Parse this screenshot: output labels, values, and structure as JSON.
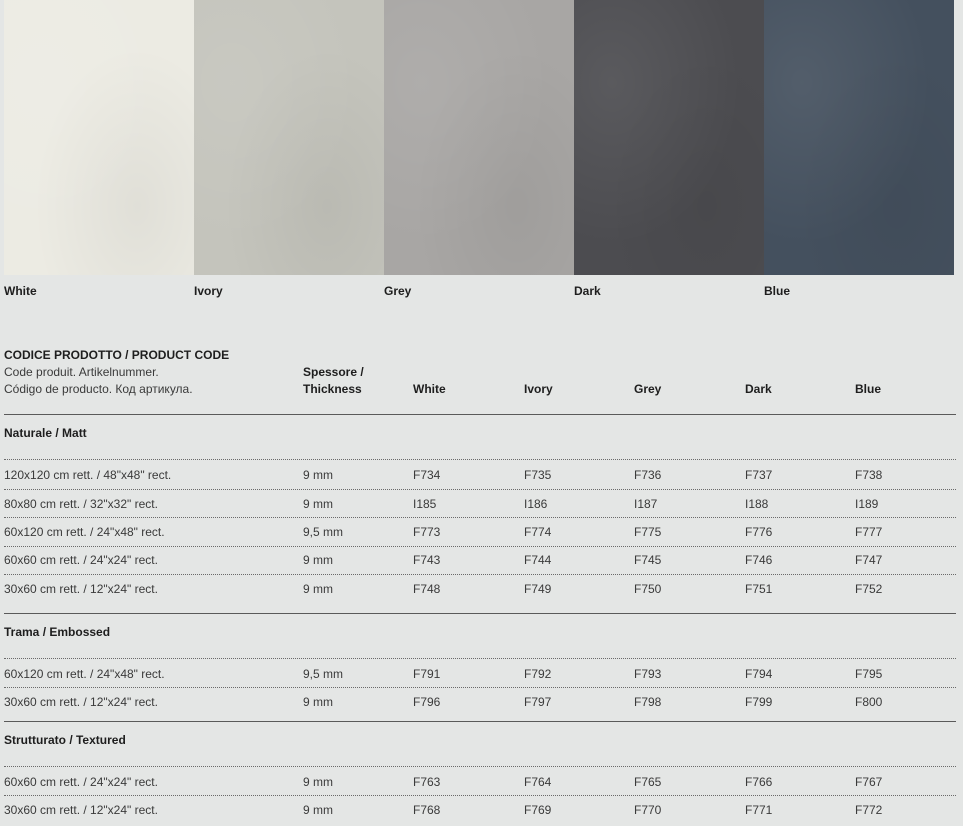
{
  "swatches": [
    {
      "label": "White",
      "color": "#ecebe3"
    },
    {
      "label": "Ivory",
      "color": "#c4c4bc"
    },
    {
      "label": "Grey",
      "color": "#a8a6a4"
    },
    {
      "label": "Dark",
      "color": "#4c4c50"
    },
    {
      "label": "Blue",
      "color": "#44505e"
    }
  ],
  "header": {
    "code_title": "CODICE PRODOTTO / PRODUCT CODE",
    "code_sub1": "Code produit. Artikelnummer.",
    "code_sub2": "Código de producto. Код артикула.",
    "thickness_1": "Spessore /",
    "thickness_2": "Thickness",
    "white": "White",
    "ivory": "Ivory",
    "grey": "Grey",
    "dark": "Dark",
    "blue": "Blue"
  },
  "sections": [
    {
      "title": "Naturale / Matt",
      "rows": [
        {
          "size": "120x120 cm rett. / 48\"x48\" rect.",
          "thickness": "9 mm",
          "white": "F734",
          "ivory": "F735",
          "grey": "F736",
          "dark": "F737",
          "blue": "F738"
        },
        {
          "size": "80x80 cm rett. / 32\"x32\" rect.",
          "thickness": "9 mm",
          "white": "I185",
          "ivory": "I186",
          "grey": "I187",
          "dark": "I188",
          "blue": "I189"
        },
        {
          "size": "60x120 cm rett. / 24\"x48\" rect.",
          "thickness": "9,5 mm",
          "white": "F773",
          "ivory": "F774",
          "grey": "F775",
          "dark": "F776",
          "blue": "F777"
        },
        {
          "size": "60x60 cm rett. / 24\"x24\" rect.",
          "thickness": "9 mm",
          "white": "F743",
          "ivory": "F744",
          "grey": "F745",
          "dark": "F746",
          "blue": "F747"
        },
        {
          "size": "30x60 cm rett. / 12\"x24\" rect.",
          "thickness": "9 mm",
          "white": "F748",
          "ivory": "F749",
          "grey": "F750",
          "dark": "F751",
          "blue": "F752"
        }
      ]
    },
    {
      "title": "Trama / Embossed",
      "rows": [
        {
          "size": "60x120 cm rett. / 24\"x48\" rect.",
          "thickness": "9,5 mm",
          "white": "F791",
          "ivory": "F792",
          "grey": "F793",
          "dark": "F794",
          "blue": "F795"
        },
        {
          "size": "30x60 cm rett. / 12\"x24\" rect.",
          "thickness": "9 mm",
          "white": "F796",
          "ivory": "F797",
          "grey": "F798",
          "dark": "F799",
          "blue": "F800"
        }
      ]
    },
    {
      "title": "Strutturato / Textured",
      "rows": [
        {
          "size": "60x60 cm rett. / 24\"x24\" rect.",
          "thickness": "9 mm",
          "white": "F763",
          "ivory": "F764",
          "grey": "F765",
          "dark": "F766",
          "blue": "F767"
        },
        {
          "size": "30x60 cm rett. / 12\"x24\" rect.",
          "thickness": "9 mm",
          "white": "F768",
          "ivory": "F769",
          "grey": "F770",
          "dark": "F771",
          "blue": "F772"
        }
      ]
    }
  ]
}
